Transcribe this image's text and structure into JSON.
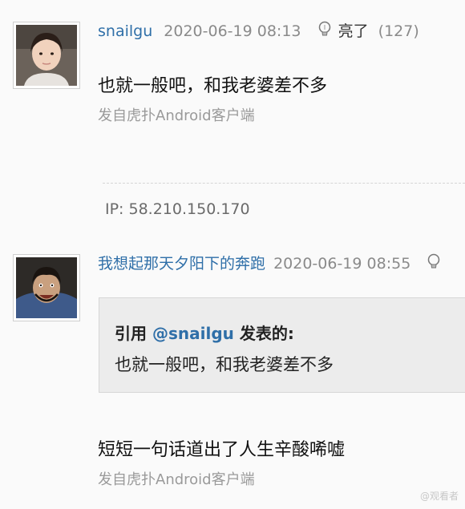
{
  "posts": [
    {
      "username": "snailgu",
      "time": "2020-06-19 08:13",
      "light_label": "亮了",
      "light_count": "(127)",
      "content": "也就一般吧，和我老婆差不多",
      "source": "发自虎扑Android客户端",
      "ip": "IP: 58.210.150.170"
    },
    {
      "username": "我想起那天夕阳下的奔跑",
      "time": "2020-06-19 08:55",
      "quote": {
        "prefix": "引用 ",
        "user": "@snailgu",
        "suffix": " 发表的:",
        "text": "也就一般吧，和我老婆差不多"
      },
      "content": "短短一句话道出了人生辛酸唏嘘",
      "source": "发自虎扑Android客户端"
    }
  ],
  "watermark": "@观看者"
}
